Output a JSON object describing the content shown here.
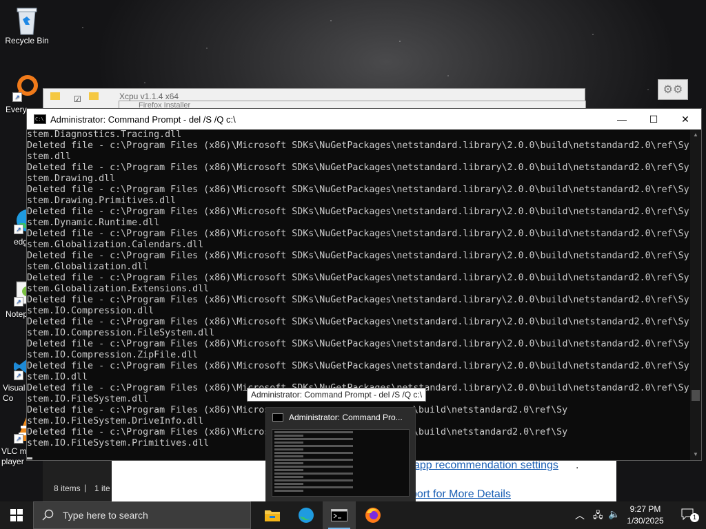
{
  "desktop": {
    "icons": [
      {
        "label": "Recycle Bin"
      },
      {
        "label": "Every"
      },
      {
        "label": "edg"
      },
      {
        "label": "Notep"
      },
      {
        "label": "Visual\nCo"
      },
      {
        "label": "VLC m\nplayer"
      }
    ]
  },
  "background_windows": {
    "explorer_title": "Xcpu v1.1.4 x64",
    "installer_title": "Firefox Installer",
    "status_items": "8 items",
    "status_sel": "1 ite",
    "link1": "app recommendation settings",
    "link1_suffix": ".",
    "link2": "port for More Details"
  },
  "cmd": {
    "title": "Administrator: Command Prompt - del  /S /Q c:\\",
    "minimize": "—",
    "maximize": "☐",
    "close": "✕",
    "lines": [
      "stem.Diagnostics.Tracing.dll",
      "Deleted file - c:\\Program Files (x86)\\Microsoft SDKs\\NuGetPackages\\netstandard.library\\2.0.0\\build\\netstandard2.0\\ref\\Sy",
      "stem.dll",
      "Deleted file - c:\\Program Files (x86)\\Microsoft SDKs\\NuGetPackages\\netstandard.library\\2.0.0\\build\\netstandard2.0\\ref\\Sy",
      "stem.Drawing.dll",
      "Deleted file - c:\\Program Files (x86)\\Microsoft SDKs\\NuGetPackages\\netstandard.library\\2.0.0\\build\\netstandard2.0\\ref\\Sy",
      "stem.Drawing.Primitives.dll",
      "Deleted file - c:\\Program Files (x86)\\Microsoft SDKs\\NuGetPackages\\netstandard.library\\2.0.0\\build\\netstandard2.0\\ref\\Sy",
      "stem.Dynamic.Runtime.dll",
      "Deleted file - c:\\Program Files (x86)\\Microsoft SDKs\\NuGetPackages\\netstandard.library\\2.0.0\\build\\netstandard2.0\\ref\\Sy",
      "stem.Globalization.Calendars.dll",
      "Deleted file - c:\\Program Files (x86)\\Microsoft SDKs\\NuGetPackages\\netstandard.library\\2.0.0\\build\\netstandard2.0\\ref\\Sy",
      "stem.Globalization.dll",
      "Deleted file - c:\\Program Files (x86)\\Microsoft SDKs\\NuGetPackages\\netstandard.library\\2.0.0\\build\\netstandard2.0\\ref\\Sy",
      "stem.Globalization.Extensions.dll",
      "Deleted file - c:\\Program Files (x86)\\Microsoft SDKs\\NuGetPackages\\netstandard.library\\2.0.0\\build\\netstandard2.0\\ref\\Sy",
      "stem.IO.Compression.dll",
      "Deleted file - c:\\Program Files (x86)\\Microsoft SDKs\\NuGetPackages\\netstandard.library\\2.0.0\\build\\netstandard2.0\\ref\\Sy",
      "stem.IO.Compression.FileSystem.dll",
      "Deleted file - c:\\Program Files (x86)\\Microsoft SDKs\\NuGetPackages\\netstandard.library\\2.0.0\\build\\netstandard2.0\\ref\\Sy",
      "stem.IO.Compression.ZipFile.dll",
      "Deleted file - c:\\Program Files (x86)\\Microsoft SDKs\\NuGetPackages\\netstandard.library\\2.0.0\\build\\netstandard2.0\\ref\\Sy",
      "stem.IO.dll",
      "Deleted file - c:\\Program Files (x86)\\Microsoft SDKs\\NuGetPackages\\netstandard.library\\2.0.0\\build\\netstandard2.0\\ref\\Sy",
      "stem.IO.FileSystem.dll",
      "Deleted file - c:\\Program Files (x86)\\Micros",
      "stem.IO.FileSystem.DriveInfo.dll",
      "Deleted file - c:\\Program Files (x86)\\Micros",
      "stem.IO.FileSystem.Primitives.dll"
    ],
    "right_tails": [
      {
        "row": 25,
        "text": "\\build\\netstandard2.0\\ref\\Sy"
      },
      {
        "row": 27,
        "text": "\\build\\netstandard2.0\\ref\\Sy"
      }
    ]
  },
  "tooltip": "Administrator: Command Prompt - del  /S /Q c:\\",
  "preview": {
    "title": "Administrator: Command Pro..."
  },
  "taskbar": {
    "search_placeholder": "Type here to search",
    "apps": [
      {
        "name": "file-explorer"
      },
      {
        "name": "edge"
      },
      {
        "name": "command-prompt",
        "active": true
      },
      {
        "name": "firefox"
      }
    ],
    "time": "9:27 PM",
    "date": "1/30/2025",
    "notification_count": "1"
  }
}
